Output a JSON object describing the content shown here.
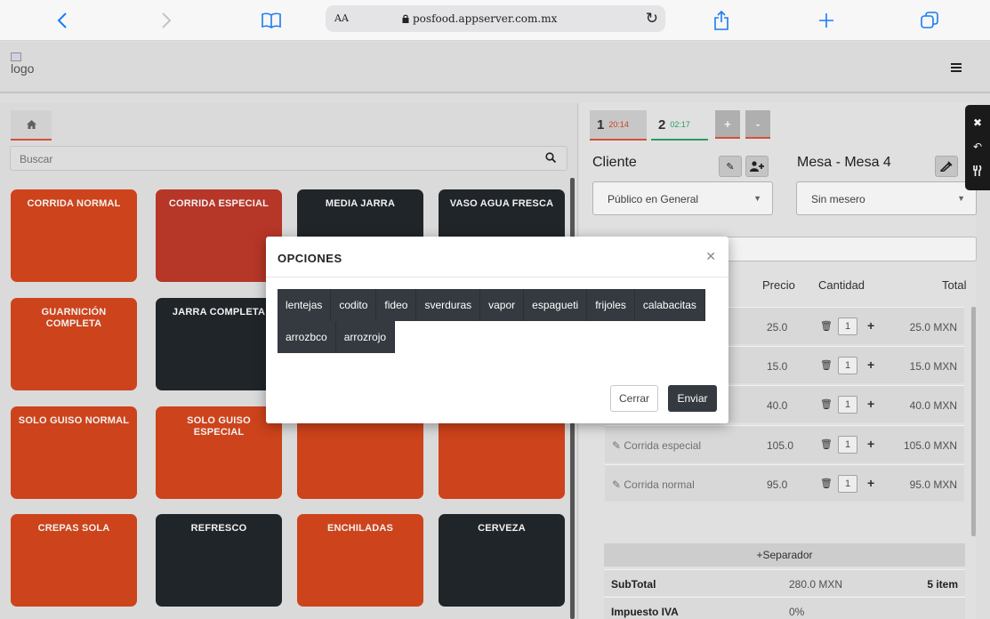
{
  "browser": {
    "text_size_label": "AA",
    "url": "posfood.appserver.com.mx"
  },
  "header": {
    "logo_alt": "logo"
  },
  "left": {
    "search_placeholder": "Buscar",
    "tiles": [
      {
        "label": "CORRIDA NORMAL",
        "color": "#d9471d"
      },
      {
        "label": "CORRIDA ESPECIAL",
        "color": "#c0392b"
      },
      {
        "label": "MEDIA JARRA",
        "color": "#22272c"
      },
      {
        "label": "VASO AGUA FRESCA",
        "color": "#22272c"
      },
      {
        "label": "GUARNICIÓN COMPLETA",
        "color": "#d9471d"
      },
      {
        "label": "JARRA COMPLETA",
        "color": "#22272c"
      },
      {
        "label": "",
        "color": "#22272c"
      },
      {
        "label": "",
        "color": "#22272c"
      },
      {
        "label": "SOLO GUISO NORMAL",
        "color": "#d9471d"
      },
      {
        "label": "SOLO GUISO ESPECIAL",
        "color": "#d9471d"
      },
      {
        "label": "",
        "color": "#d9471d"
      },
      {
        "label": "",
        "color": "#d9471d"
      },
      {
        "label": "CREPAS SOLA",
        "color": "#d9471d"
      },
      {
        "label": "REFRESCO",
        "color": "#22272c"
      },
      {
        "label": "ENCHILADAS",
        "color": "#d9471d"
      },
      {
        "label": "CERVEZA",
        "color": "#22272c"
      }
    ]
  },
  "right": {
    "tabs": [
      {
        "num": "1",
        "time": "20:14"
      },
      {
        "num": "2",
        "time": "02:17"
      }
    ],
    "add_tab": "+",
    "remove_tab": "-",
    "cliente_label": "Cliente",
    "mesa_label": "Mesa - Mesa 4",
    "cliente_select": "Público en General",
    "mesero_select": "Sin mesero",
    "columns": {
      "precio": "Precio",
      "cantidad": "Cantidad",
      "total": "Total"
    },
    "items": [
      {
        "name": "",
        "price": "25.0",
        "qty": "1",
        "total": "25.0 MXN"
      },
      {
        "name": "",
        "price": "15.0",
        "qty": "1",
        "total": "15.0 MXN"
      },
      {
        "name": "",
        "price": "40.0",
        "qty": "1",
        "total": "40.0 MXN"
      },
      {
        "name": "Corrida especial",
        "price": "105.0",
        "qty": "1",
        "total": "105.0 MXN"
      },
      {
        "name": "Corrida normal",
        "price": "95.0",
        "qty": "1",
        "total": "95.0 MXN"
      }
    ],
    "separator": "+Separador",
    "subtotal": {
      "label": "SubTotal",
      "value": "280.0 MXN",
      "count": "5 item"
    },
    "iva": {
      "label": "Impuesto IVA",
      "value": "0%"
    }
  },
  "modal": {
    "title": "OPCIONES",
    "options": [
      "lentejas",
      "codito",
      "fideo",
      "sverduras",
      "vapor",
      "espagueti",
      "frijoles",
      "calabacitas",
      "arrozbco",
      "arrozrojo"
    ],
    "close_label": "Cerrar",
    "send_label": "Enviar"
  }
}
